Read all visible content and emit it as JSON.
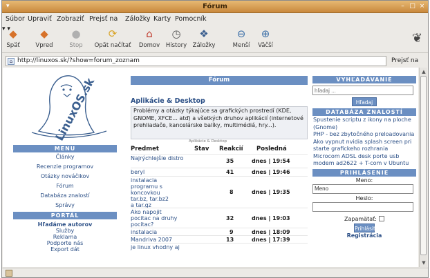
{
  "window": {
    "title": "Fórum"
  },
  "menubar": [
    "Súbor",
    "Upraviť",
    "Zobraziť",
    "Prejsť na",
    "Záložky",
    "Karty",
    "Pomocník"
  ],
  "toolbar": [
    {
      "label": "Späť",
      "icon": "back-arrow-icon"
    },
    {
      "label": "Vpred",
      "icon": "forward-arrow-icon"
    },
    {
      "label": "Stop",
      "icon": "stop-icon"
    },
    {
      "label": "Opät načítať",
      "icon": "reload-icon"
    },
    {
      "label": "Domov",
      "icon": "home-icon"
    },
    {
      "label": "History",
      "icon": "history-icon"
    },
    {
      "label": "Záložky",
      "icon": "bookmarks-icon"
    },
    {
      "label": "Menší",
      "icon": "zoom-out-icon"
    },
    {
      "label": "Väčší",
      "icon": "zoom-in-icon"
    }
  ],
  "urlbar": {
    "url": "http://linuxos.sk/?show=forum_zoznam",
    "go": "Prejsť na"
  },
  "page": {
    "logo_text": "LinuxOS.sk",
    "menu": {
      "header": "MENU",
      "items": [
        "Články",
        "Recenzie programov",
        "Otázky nováčikov",
        "Fórum",
        "Databáza znalostí",
        "Správy"
      ]
    },
    "portal": {
      "header": "PORTÁL",
      "items": [
        "Hľadáme autorov",
        "Služby",
        "Reklama",
        "Podporte nás",
        "Export dát"
      ]
    },
    "forum": {
      "header": "Fórum",
      "category_title": "Aplikácie & Desktop",
      "category_desc": "Problémy a otázky týkajúce sa grafických prostredí (KDE, GNOME, XFCE... atď) a všetkých druhov aplikácií (internetové prehliadače, kancelárske balíky, multimédiá, hry...).",
      "category_sub": "Aplikácie & Desktop",
      "columns": {
        "subject": "Predmet",
        "status": "Stav",
        "replies": "Reakcií",
        "last": "Posledná"
      },
      "rows": [
        {
          "subject": "Najrýchlejšie distro",
          "replies": "35",
          "last": "dnes | 19:54"
        },
        {
          "subject": "beryl",
          "replies": "41",
          "last": "dnes | 19:46"
        },
        {
          "subject": "instalacia programu s koncovkou tar.bz, tar.bz2 a tar.gz",
          "replies": "8",
          "last": "dnes | 19:35"
        },
        {
          "subject": "Ako napojit pocitac na druhy pocitac?",
          "replies": "32",
          "last": "dnes | 19:03"
        },
        {
          "subject": "instalacia",
          "replies": "9",
          "last": "dnes | 18:09"
        },
        {
          "subject": "Mandriva 2007",
          "replies": "13",
          "last": "dnes | 17:39"
        },
        {
          "subject": "je linux vhodny aj",
          "replies": "",
          "last": ""
        }
      ]
    },
    "search": {
      "header": "VYHĽADÁVANIE",
      "placeholder": "hľadaj ...",
      "button": "Hľadaj"
    },
    "knowledge": {
      "header": "DATABÁZA ZNALOSTÍ",
      "links": [
        "Spustenie scriptu z ikony na ploche (Gnome)",
        "PHP - bez zbytočného preloadovania",
        "Ako vypnut nvidia splash screen pri starte grafickeho rozhrania",
        "Microcom ADSL desk porte usb modem ad2622 + T-com v Ubuntu"
      ]
    },
    "login": {
      "header": "PRIHLÁSENIE",
      "name_label": "Meno:",
      "name_value": "Meno",
      "pass_label": "Heslo:",
      "remember": "Zapamätať:",
      "button": "Prihlásiť",
      "register": "Registrácia"
    }
  },
  "colors": {
    "titlebar": "#c9883c",
    "accent": "#6b8fc2",
    "link": "#2b4f86"
  }
}
